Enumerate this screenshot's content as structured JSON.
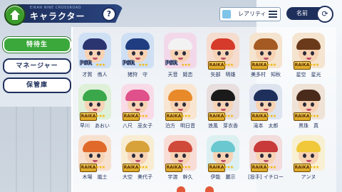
{
  "header": {
    "title_sub": "EIKAN NINE CROSSROAD",
    "title": "キャラクター",
    "help_label": "?",
    "filter_label": "レアリティ",
    "sort_label": "名前"
  },
  "menu": [
    {
      "label": "特待生",
      "active": true
    },
    {
      "label": "マネージャー",
      "active": false
    },
    {
      "label": "保管庫",
      "active": false
    }
  ],
  "characters": [
    {
      "name": "才賀　侑人",
      "badge": "PSR",
      "hair": "#2b3570",
      "bg": "#cfe0f5"
    },
    {
      "name": "猪狩　守",
      "badge": "PSR",
      "hair": "#1f3d80",
      "bg": "#cfe0f5"
    },
    {
      "name": "天音　姫恋",
      "badge": "PSR",
      "hair": "#f2f2f2",
      "bg": "#f3d8ea"
    },
    {
      "name": "矢部　明雄",
      "badge": "",
      "hair": "#d63a2a",
      "bg": "#f5dccf"
    },
    {
      "name": "美多村　知秋",
      "badge": "",
      "hair": "#a45a22",
      "bg": "#f5e4cf"
    },
    {
      "name": "星空　星光",
      "badge": "",
      "hair": "#6b3a1a",
      "bg": "#f5e4cf"
    },
    {
      "name": "早川　あおい",
      "badge": "",
      "hair": "#3aa84a",
      "bg": "#dff0d8"
    },
    {
      "name": "八尺　巫女子",
      "badge": "",
      "hair": "#e0508a",
      "bg": "#f8dbe7"
    },
    {
      "name": "泊方　明日音",
      "badge": "",
      "hair": "#e88a2a",
      "bg": "#f8e6d2"
    },
    {
      "name": "浪風　芽衣香",
      "badge": "",
      "hair": "#1a1a1a",
      "bg": "#e8dede"
    },
    {
      "name": "滝本　太郎",
      "badge": "",
      "hair": "#1e2f5c",
      "bg": "#dde3ef"
    },
    {
      "name": "黒珠　真",
      "badge": "",
      "hair": "#4a2a1a",
      "bg": "#efe2d6"
    },
    {
      "name": "木場　嵐士",
      "badge": "",
      "hair": "#e06a2a",
      "bg": "#f8e0cf"
    },
    {
      "name": "大空　美代子",
      "badge": "",
      "hair": "#d8a23a",
      "bg": "#f8ecd2"
    },
    {
      "name": "宇渡　幹久",
      "badge": "",
      "hair": "#d04a3a",
      "bg": "#f8dcd6"
    },
    {
      "name": "伊能　麗示",
      "badge": "",
      "hair": "#6ac8d0",
      "bg": "#dcf0f2"
    },
    {
      "name": "[投手] イチロー",
      "badge": "",
      "hair": "#c83a3a",
      "bg": "#f2dcdc"
    },
    {
      "name": "アンヌ",
      "badge": "",
      "hair": "#f0c83a",
      "bg": "#f8f0d2"
    }
  ],
  "rank_badge": "RAIKA",
  "stars": "★★★",
  "colors": {
    "accent": "#3aa83a",
    "navy": "#1e2f5c",
    "gold": "#f2b705"
  }
}
